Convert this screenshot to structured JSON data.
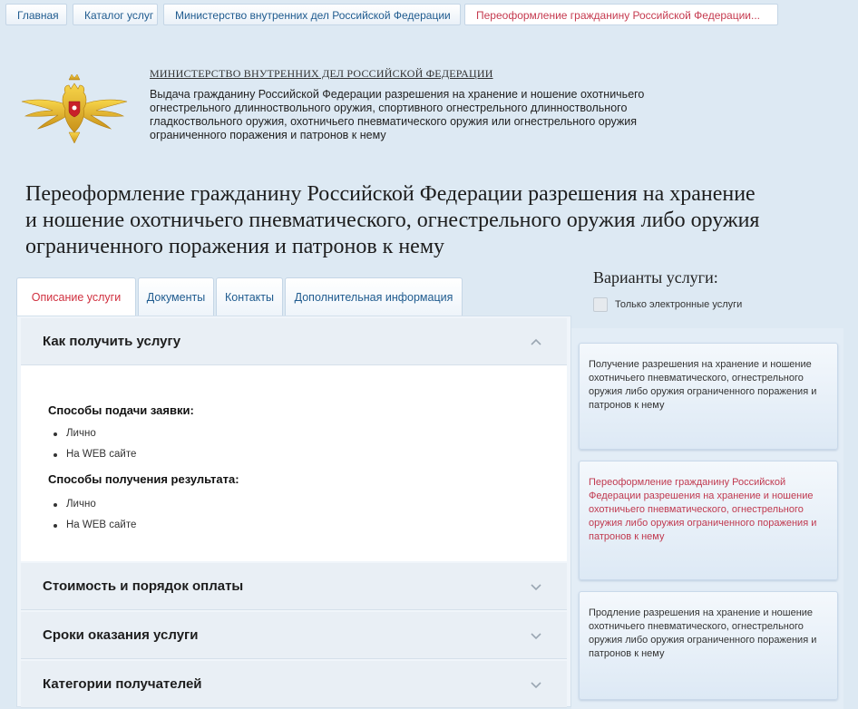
{
  "breadcrumbs": [
    {
      "label": "Главная"
    },
    {
      "label": "Каталог услуг"
    },
    {
      "label": "Министерство внутренних дел Российской Федерации"
    },
    {
      "label": "Переоформление гражданину Российской Федерации..."
    }
  ],
  "ministry": {
    "name": "МИНИСТЕРСТВО ВНУТРЕННИХ ДЕЛ РОССИЙСКОЙ ФЕДЕРАЦИИ",
    "description_lines": [
      "Выдача гражданину Российской Федерации разрешения на хранение и ношение охотничьего",
      "огнестрельного длинноствольного оружия, спортивного огнестрельного длинноствольного",
      "гладкоствольного оружия, охотничьего пневматического оружия или огнестрельного оружия",
      "ограниченного поражения и патронов к нему"
    ]
  },
  "page": {
    "title_lines": [
      "Переоформление гражданину Российской Федерации разрешения на хранение",
      "и ношение охотничьего пневматического, огнестрельного оружия либо оружия",
      "ограниченного поражения и патронов к нему"
    ]
  },
  "tabs": [
    {
      "label": "Описание услуги",
      "active": true
    },
    {
      "label": "Документы",
      "active": false
    },
    {
      "label": "Контакты",
      "active": false
    },
    {
      "label": "Дополнительная информация",
      "active": false
    }
  ],
  "accordion": {
    "open_section": {
      "title": "Как получить услугу",
      "submit_heading": "Способы подачи заявки:",
      "submit_methods": [
        "Лично",
        "На WEB сайте"
      ],
      "result_heading": "Способы получения результата:",
      "result_methods": [
        "Лично",
        "На WEB сайте"
      ]
    },
    "collapsed_sections": [
      {
        "title": "Стоимость и порядок оплаты"
      },
      {
        "title": "Сроки оказания услуги"
      },
      {
        "title": "Категории получателей"
      }
    ]
  },
  "sidebar": {
    "title": "Варианты услуги:",
    "filter_label": "Только электронные услуги",
    "variants": [
      {
        "text": "Получение разрешения на хранение и ношение охотничьего пневматического, огнестрельного оружия либо оружия ограниченного поражения и патронов к нему",
        "active": false
      },
      {
        "text": "Переоформление гражданину Российской Федерации разрешения на хранение и ношение охотничьего пневматического, огнестрельного оружия либо оружия ограниченного поражения и патронов к нему",
        "active": true
      },
      {
        "text": "Продление разрешения на хранение и ношение охотничьего пневматического, огнестрельного оружия либо оружия ограниченного поражения и патронов к нему",
        "active": false
      }
    ]
  },
  "colors": {
    "accent_red": "#d0303f",
    "link_blue": "#1f5b8f",
    "page_bg": "#dde9f3"
  }
}
